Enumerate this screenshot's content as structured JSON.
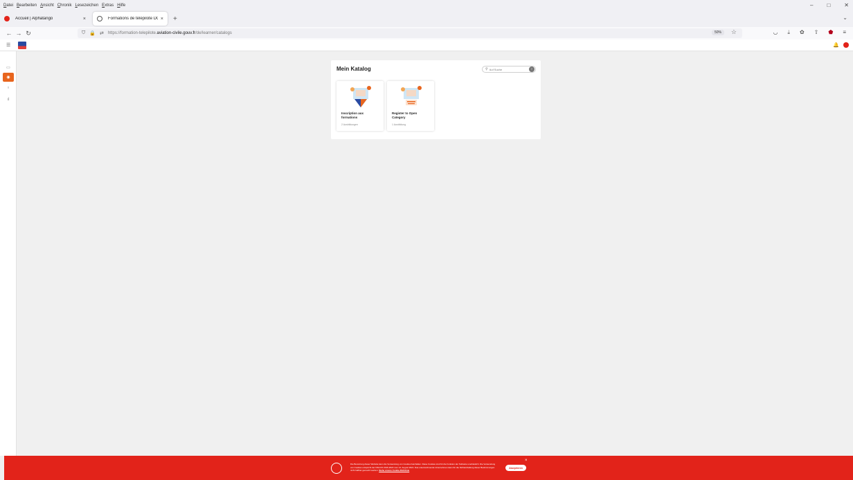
{
  "menubar": {
    "items": [
      "Datei",
      "Bearbeiten",
      "Ansicht",
      "Chronik",
      "Lesezeichen",
      "Extras",
      "Hilfe"
    ]
  },
  "tabs": [
    {
      "title": "Accueil | Alphatango",
      "active": false,
      "close": "×"
    },
    {
      "title": "Formations de télépilote DGAC",
      "active": true,
      "close": "×"
    }
  ],
  "urlbar": {
    "url_prefix": "https://formation-telepilote.",
    "url_domain": "aviation-civile.gouv.fr",
    "url_suffix": "/de/learner/catalogs",
    "zoom": "50%"
  },
  "catalog": {
    "title": "Mein Katalog",
    "search_placeholder": "Auf Suche",
    "cards": [
      {
        "title": "Inscription aux formations",
        "meta": "2 Ausbildungen"
      },
      {
        "title": "Register to Open Category",
        "meta": "1 Ausbildung"
      }
    ]
  },
  "cookie_banner": {
    "text": "Die Benutzung dieser Website kann die Verwendung von Cookies beinhalten. Diese Cookies sind für die Funktion der Software unerlässlich. Die Verwendung von Cookies entspricht der DSGVO 2016-2024 vom 14. August 2021. Das unterzeichnende Unternehmen kann für die Nichteinhaltung dieser Bestimmungen nicht haftbar gemacht werden.",
    "link": "Siehe unsere Cookie-Richtlinie",
    "accept": "Akzeptieren"
  },
  "colors": {
    "accent": "#e8651e",
    "brand_red": "#e2231a",
    "logo_blue": "#2a4aa1"
  },
  "icons": {
    "back": "arrow-left-icon",
    "forward": "arrow-right-icon",
    "reload": "reload-icon",
    "shield": "shield-icon",
    "lock": "lock-icon",
    "bookmark": "star-icon",
    "bell": "bell-icon",
    "menu": "hamburger-icon",
    "search": "search-icon"
  }
}
